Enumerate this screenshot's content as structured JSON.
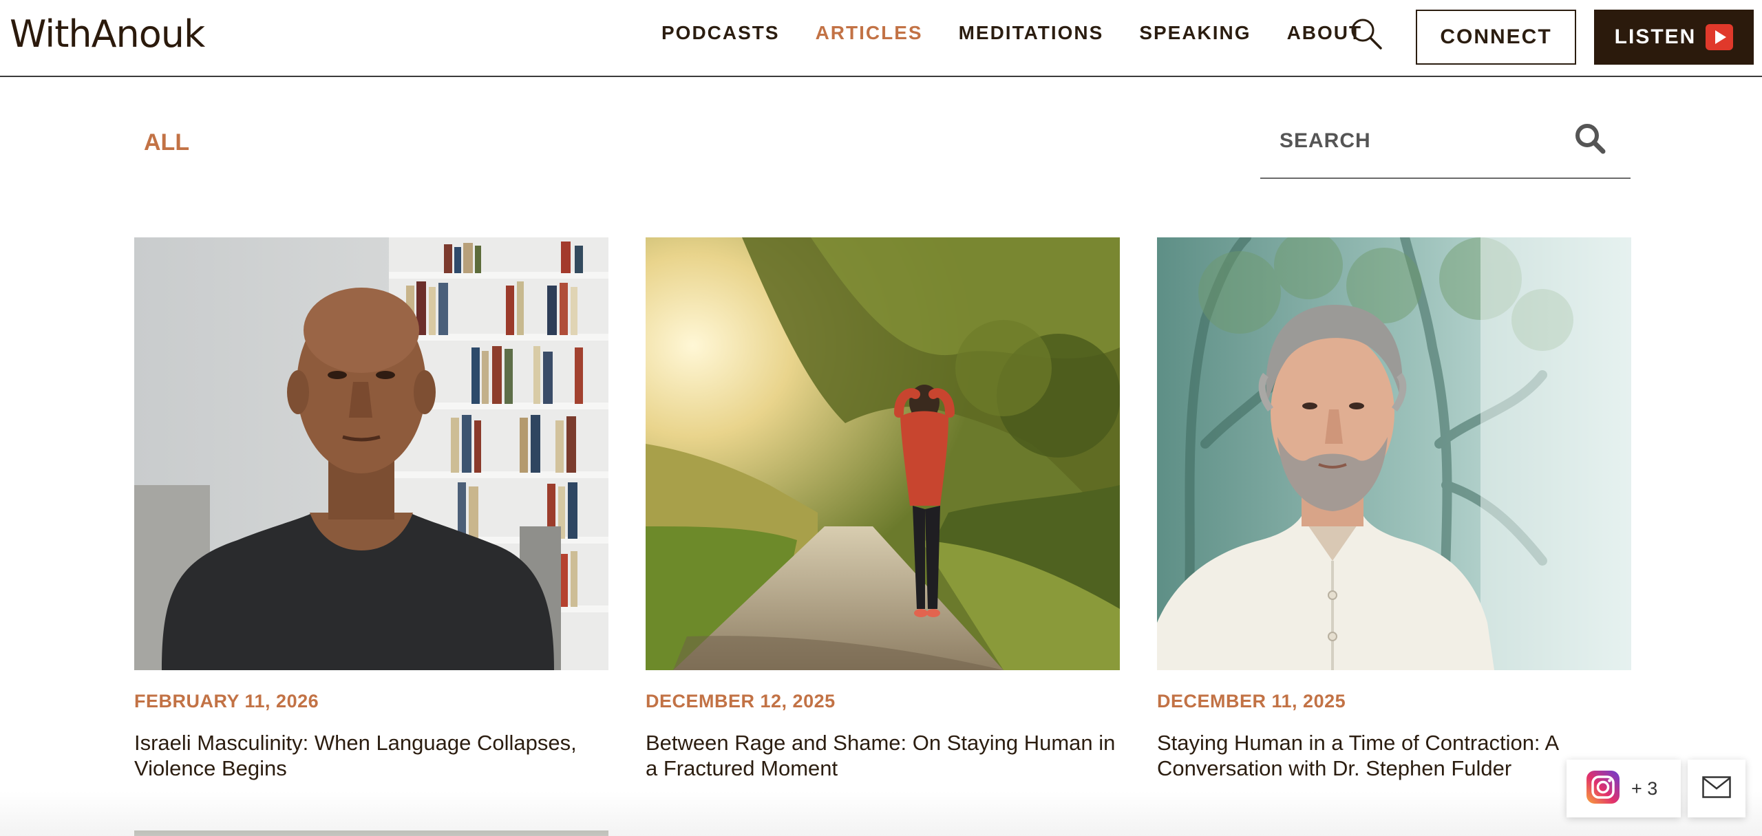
{
  "site": {
    "logo": "WithAnouk"
  },
  "nav": {
    "items": [
      {
        "label": "PODCASTS",
        "active": false
      },
      {
        "label": "ARTICLES",
        "active": true
      },
      {
        "label": "MEDITATIONS",
        "active": false
      },
      {
        "label": "SPEAKING",
        "active": false
      },
      {
        "label": "ABOUT",
        "active": false
      }
    ],
    "search_icon": "search-icon",
    "connect_label": "CONNECT",
    "listen_label": "LISTEN",
    "listen_icon": "play-icon"
  },
  "filter": {
    "all_label": "ALL",
    "search_placeholder": "SEARCH",
    "search_icon": "search-icon"
  },
  "articles": [
    {
      "date": "FEBRUARY 11, 2026",
      "title": "Israeli Masculinity: When Language Collapses, Violence Begins",
      "image": "portrait of bald man in dark sweater in front of bookshelf"
    },
    {
      "date": "DECEMBER 12, 2025",
      "title": "Between Rage and Shame: On Staying Human in a Fractured Moment",
      "image": "woman in red hoodie walking down a sunlit tree-lined path"
    },
    {
      "date": "DECEMBER 11, 2025",
      "title": "Staying Human in a Time of Contraction: A Conversation with Dr. Stephen Fulder",
      "image": "grey-haired bearded man in white shirt over misty teal forest"
    }
  ],
  "social": {
    "count_label": "+ 3",
    "instagram_icon": "instagram-icon",
    "mail_icon": "mail-icon"
  },
  "colors": {
    "accent": "#c27245",
    "dark": "#2b1a0c",
    "play_red": "#e0392b"
  }
}
